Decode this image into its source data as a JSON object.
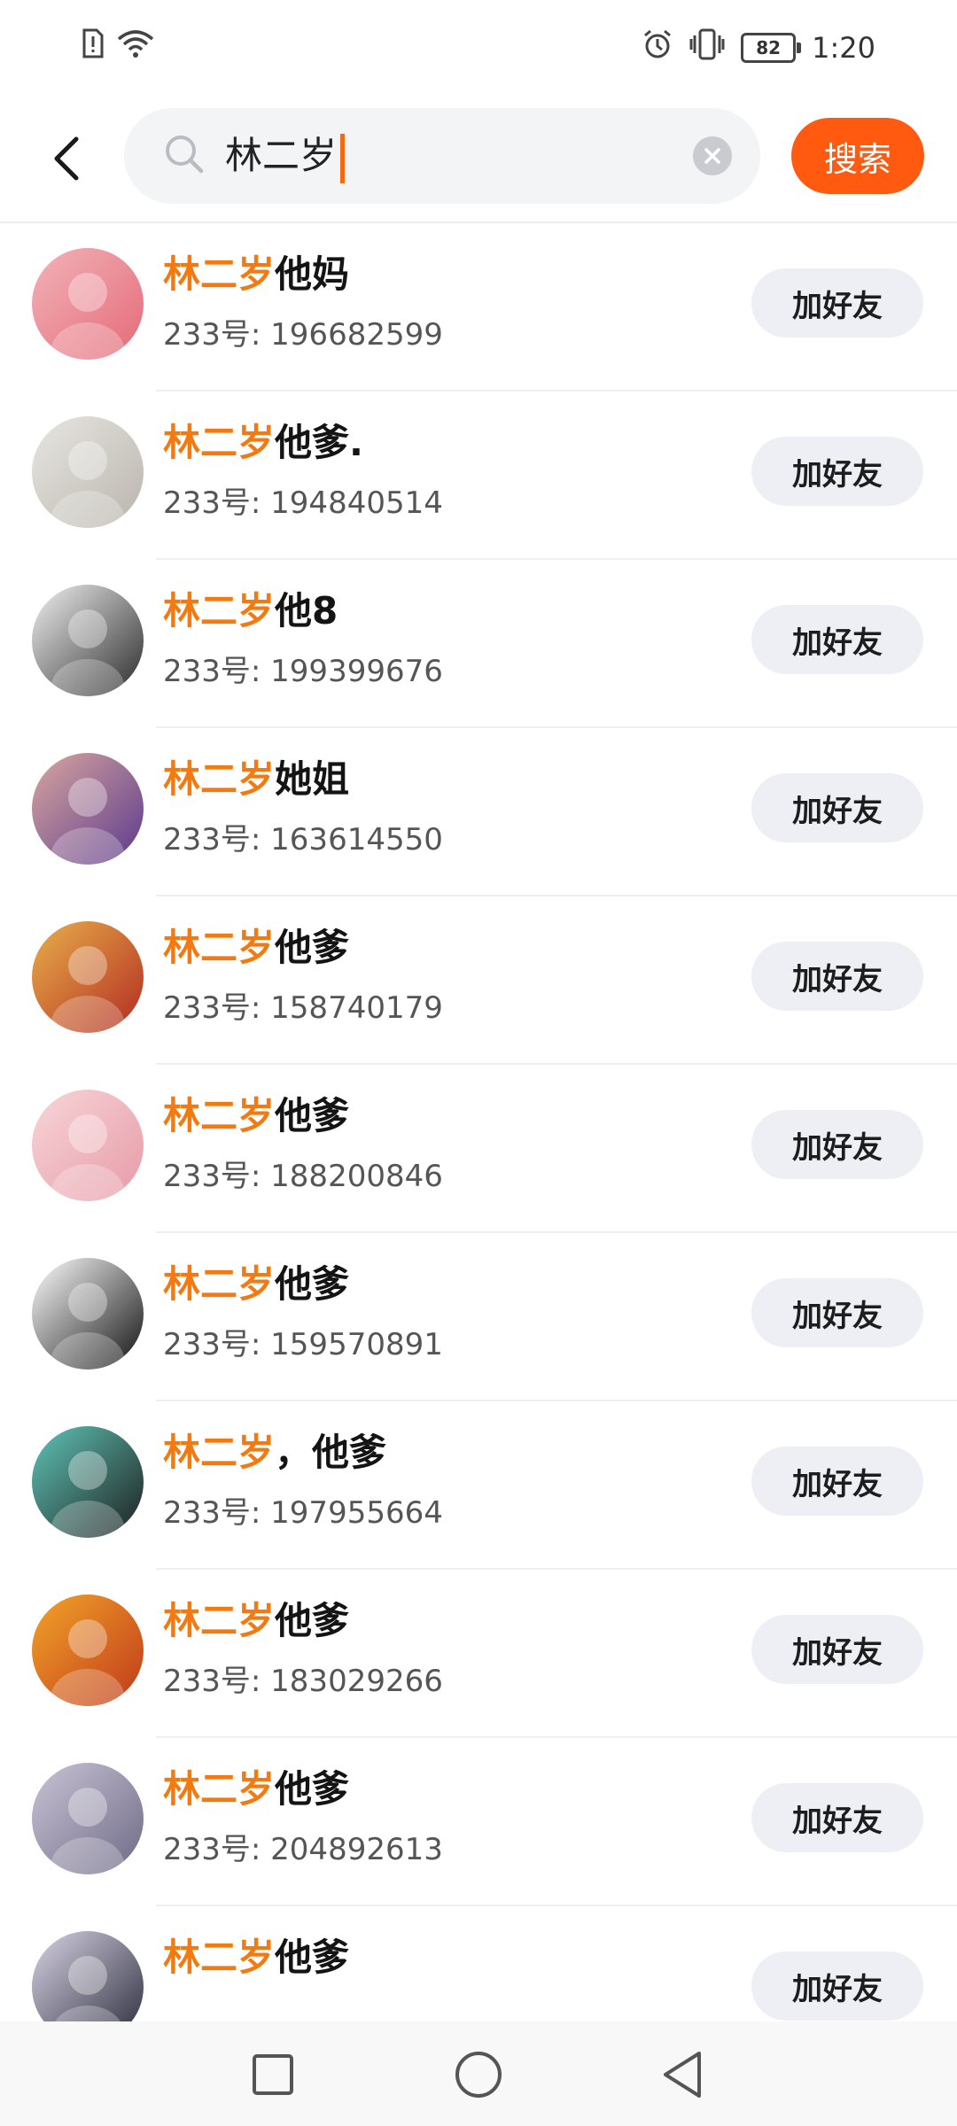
{
  "status_bar": {
    "time": "1:20",
    "battery": "82",
    "left_icons": [
      "sim-alert-icon",
      "wifi-icon"
    ],
    "right_icons": [
      "alarm-icon",
      "vibrate-icon",
      "battery-icon"
    ]
  },
  "search": {
    "value": "林二岁",
    "button_label": "搜索",
    "accent": "#ff5a0f"
  },
  "colors": {
    "highlight": "#f27a10",
    "add_button_bg": "#eeeff5"
  },
  "results": [
    {
      "highlight": "林二岁",
      "rest": "他妈",
      "id_prefix": "233号: ",
      "id": "196682599",
      "add_label": "加好友",
      "avatar_colors": [
        "#f3b3b8",
        "#e46a78"
      ]
    },
    {
      "highlight": "林二岁",
      "rest": "他爹.",
      "id_prefix": "233号: ",
      "id": "194840514",
      "add_label": "加好友",
      "avatar_colors": [
        "#e8e6e2",
        "#b9b5ad"
      ]
    },
    {
      "highlight": "林二岁",
      "rest": "他8",
      "id_prefix": "233号: ",
      "id": "199399676",
      "add_label": "加好友",
      "avatar_colors": [
        "#f1f1f1",
        "#2a2a2a"
      ]
    },
    {
      "highlight": "林二岁",
      "rest": "她姐",
      "id_prefix": "233号: ",
      "id": "163614550",
      "add_label": "加好友",
      "avatar_colors": [
        "#d9a7a0",
        "#5b3a8c"
      ]
    },
    {
      "highlight": "林二岁",
      "rest": "他爹",
      "id_prefix": "233号: ",
      "id": "158740179",
      "add_label": "加好友",
      "avatar_colors": [
        "#e9b04a",
        "#b22b22"
      ]
    },
    {
      "highlight": "林二岁",
      "rest": "他爹",
      "id_prefix": "233号: ",
      "id": "188200846",
      "add_label": "加好友",
      "avatar_colors": [
        "#f7d6d9",
        "#e79aa7"
      ]
    },
    {
      "highlight": "林二岁",
      "rest": "他爹",
      "id_prefix": "233号: ",
      "id": "159570891",
      "add_label": "加好友",
      "avatar_colors": [
        "#ffffff",
        "#111111"
      ]
    },
    {
      "highlight": "林二岁",
      "rest": "，他爹",
      "id_prefix": "233号: ",
      "id": "197955664",
      "add_label": "加好友",
      "avatar_colors": [
        "#5fc5b8",
        "#1e1e1e"
      ]
    },
    {
      "highlight": "林二岁",
      "rest": "他爹",
      "id_prefix": "233号: ",
      "id": "183029266",
      "add_label": "加好友",
      "avatar_colors": [
        "#f2a42a",
        "#c0391a"
      ]
    },
    {
      "highlight": "林二岁",
      "rest": "他爹",
      "id_prefix": "233号: ",
      "id": "204892613",
      "add_label": "加好友",
      "avatar_colors": [
        "#c9c4d6",
        "#6f6a86"
      ]
    },
    {
      "highlight": "林二岁",
      "rest": "他爹",
      "id_prefix": "",
      "id": "",
      "add_label": "加好友",
      "avatar_colors": [
        "#d8d4e6",
        "#2b2b3a"
      ]
    }
  ],
  "nav_bar": {
    "buttons": [
      "recents-square-icon",
      "home-circle-icon",
      "back-triangle-icon"
    ]
  }
}
